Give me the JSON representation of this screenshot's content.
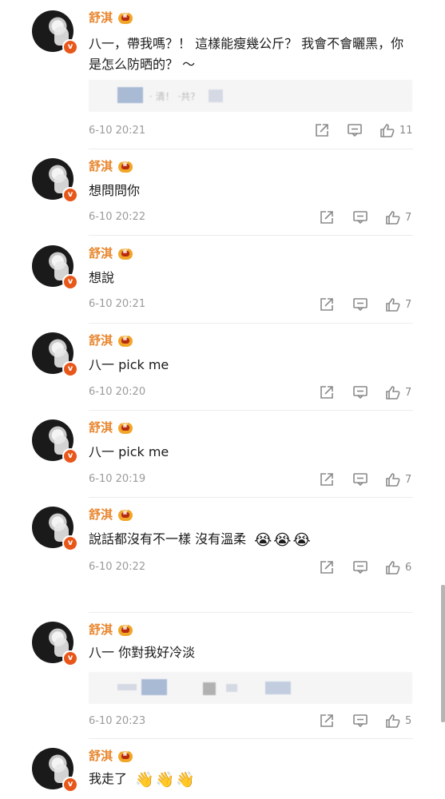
{
  "comments": [
    {
      "user": "舒淇",
      "text": "八一，帶我嗎？！ 這樣能瘦幾公斤？ 我會不會曬黑，你是怎么防晒的？ ～",
      "time": "6-10 20:21",
      "likes": "11"
    },
    {
      "user": "舒淇",
      "text": "想問問你",
      "time": "6-10 20:22",
      "likes": "7"
    },
    {
      "user": "舒淇",
      "text": "想說",
      "time": "6-10 20:21",
      "likes": "7"
    },
    {
      "user": "舒淇",
      "text": "八一 pick me",
      "time": "6-10 20:20",
      "likes": "7"
    },
    {
      "user": "舒淇",
      "text": "八一 pick me",
      "time": "6-10 20:19",
      "likes": "7"
    },
    {
      "user": "舒淇",
      "text": "說話都沒有不一樣 沒有溫柔",
      "time": "6-10 20:22",
      "likes": "6"
    },
    {
      "user": "舒淇",
      "text": "八一 你對我好冷淡",
      "time": "6-10 20:23",
      "likes": "5"
    },
    {
      "user": "舒淇",
      "text": "我走了",
      "time": "",
      "likes": ""
    }
  ],
  "emojis": {
    "crying": "😭",
    "waving": "👋"
  },
  "icons": [
    "share-icon",
    "comment-icon",
    "like-icon",
    "verified-icon",
    "crown-icon"
  ],
  "colors": {
    "username": "#e8862e",
    "badge": "#e8571a",
    "timestamp": "#9b9b9b",
    "icon": "#8a8a8a"
  }
}
